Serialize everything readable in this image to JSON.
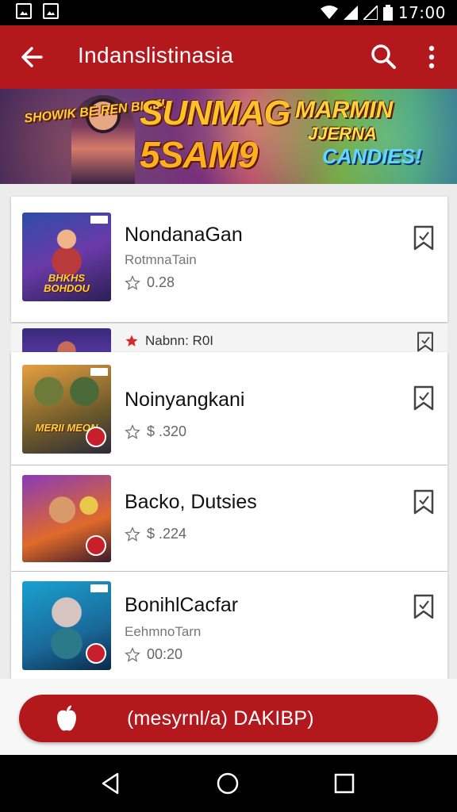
{
  "status_bar": {
    "time": "17:00"
  },
  "app_bar": {
    "title": "Indanslistinasia"
  },
  "banner": {
    "promo_left": "SHOWIK BE REN BHIEL",
    "promo_center_1": "SUNMAG",
    "promo_center_2": "5SAM9",
    "promo_right_1": "MARMIN",
    "promo_right_2": "JJERNA",
    "promo_right_3": "CANDIES!"
  },
  "items": [
    {
      "title": "NondanaGan",
      "subtitle": "RotmnaTain",
      "rating": "0.28",
      "thumb_caption": "BHKHS BOHDOU"
    },
    {
      "partial_label": "Nabnn: R0I"
    },
    {
      "title": "Noinyangkani",
      "rating": "$ .320",
      "thumb_caption": "MERII MEON"
    },
    {
      "title": "Backo, Dutsies",
      "rating": "$ .224"
    },
    {
      "title": "BonihlCacfar",
      "subtitle": "EehmnoTarn",
      "rating": "00:20"
    }
  ],
  "cta": {
    "label": "(mesyrnl/a) DAKIBP)"
  },
  "icons": {
    "back": "arrow-left-icon",
    "search": "search-icon",
    "more": "more-vert-icon",
    "bookmark": "bookmark-icon",
    "star": "star-outline-icon",
    "apple": "apple-icon"
  },
  "colors": {
    "primary": "#b3181c",
    "accent": "#d22a2a"
  }
}
